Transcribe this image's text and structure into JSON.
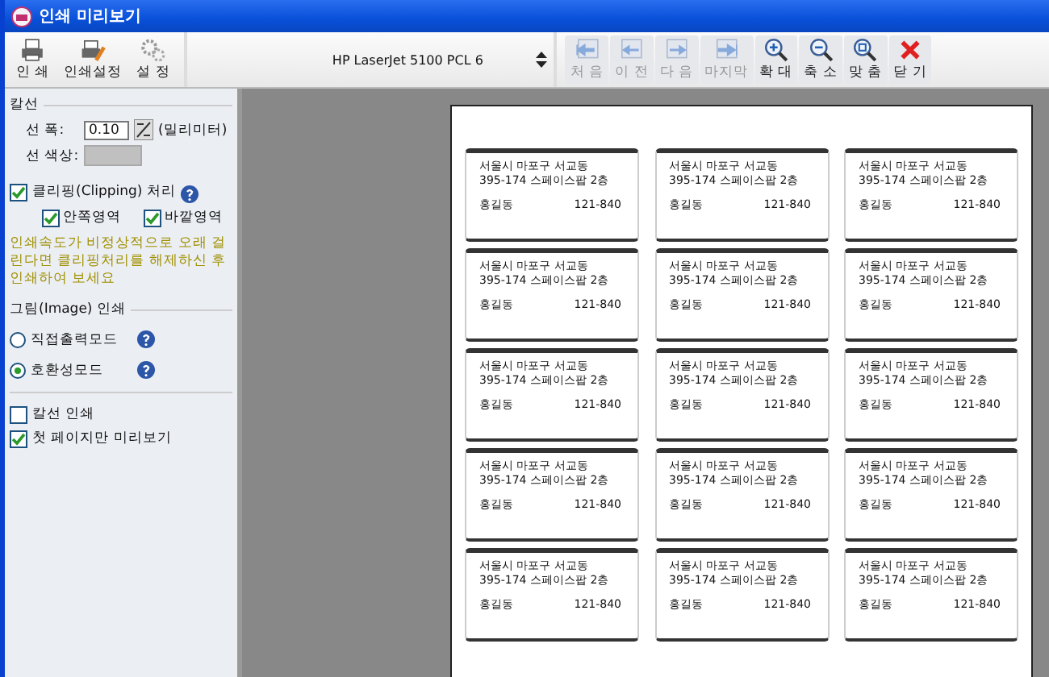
{
  "window": {
    "title": "인쇄 미리보기"
  },
  "toolbar": {
    "left_buttons": [
      {
        "kind": "print",
        "label": "인 쇄",
        "disabled": false
      },
      {
        "kind": "setup",
        "label": "인쇄설정",
        "disabled": false
      },
      {
        "kind": "settings",
        "label": "설 정",
        "disabled": false
      }
    ],
    "printer": "HP LaserJet 5100 PCL 6",
    "right_buttons": [
      {
        "kind": "first",
        "label": "처 음",
        "disabled": true
      },
      {
        "kind": "prev",
        "label": "이 전",
        "disabled": true
      },
      {
        "kind": "next",
        "label": "다 음",
        "disabled": true
      },
      {
        "kind": "last",
        "label": "마지막",
        "disabled": true
      },
      {
        "kind": "zoomin",
        "label": "확 대",
        "disabled": false
      },
      {
        "kind": "zoomout",
        "label": "축 소",
        "disabled": false
      },
      {
        "kind": "fit",
        "label": "맞 춤",
        "disabled": false
      },
      {
        "kind": "close",
        "label": "닫 기",
        "disabled": false
      }
    ]
  },
  "panel": {
    "cut_line": {
      "title": "칼선",
      "width_label": "선 폭:",
      "width_value": "0.10",
      "unit": "(밀리미터)",
      "color_label": "선 색상:"
    },
    "clipping": {
      "label": "클리핑(Clipping) 처리",
      "checked": true,
      "options": [
        {
          "label": "안쪽영역",
          "checked": true
        },
        {
          "label": "바깥영역",
          "checked": true
        }
      ],
      "note": "인쇄속도가 비정상적으로 오래 걸린다면 클리핑처리를 해제하신 후 인쇄하여 보세요"
    },
    "image": {
      "title": "그림(Image) 인쇄",
      "modes": [
        {
          "label": "직접출력모드",
          "selected": false
        },
        {
          "label": "호환성모드",
          "selected": true
        }
      ]
    },
    "options": [
      {
        "label": "칼선 인쇄",
        "checked": false
      },
      {
        "label": "첫 페이지만 미리보기",
        "checked": true
      }
    ]
  },
  "labels": [
    {
      "address_1": "서울시 마포구 서교동",
      "address_2": "395-174 스페이스팝 2층",
      "name": "홍길동",
      "zip": "121-840"
    },
    {
      "address_1": "서울시 마포구 서교동",
      "address_2": "395-174 스페이스팝 2층",
      "name": "홍길동",
      "zip": "121-840"
    },
    {
      "address_1": "서울시 마포구 서교동",
      "address_2": "395-174 스페이스팝 2층",
      "name": "홍길동",
      "zip": "121-840"
    },
    {
      "address_1": "서울시 마포구 서교동",
      "address_2": "395-174 스페이스팝 2층",
      "name": "홍길동",
      "zip": "121-840"
    },
    {
      "address_1": "서울시 마포구 서교동",
      "address_2": "395-174 스페이스팝 2층",
      "name": "홍길동",
      "zip": "121-840"
    },
    {
      "address_1": "서울시 마포구 서교동",
      "address_2": "395-174 스페이스팝 2층",
      "name": "홍길동",
      "zip": "121-840"
    },
    {
      "address_1": "서울시 마포구 서교동",
      "address_2": "395-174 스페이스팝 2층",
      "name": "홍길동",
      "zip": "121-840"
    },
    {
      "address_1": "서울시 마포구 서교동",
      "address_2": "395-174 스페이스팝 2층",
      "name": "홍길동",
      "zip": "121-840"
    },
    {
      "address_1": "서울시 마포구 서교동",
      "address_2": "395-174 스페이스팝 2층",
      "name": "홍길동",
      "zip": "121-840"
    },
    {
      "address_1": "서울시 마포구 서교동",
      "address_2": "395-174 스페이스팝 2층",
      "name": "홍길동",
      "zip": "121-840"
    },
    {
      "address_1": "서울시 마포구 서교동",
      "address_2": "395-174 스페이스팝 2층",
      "name": "홍길동",
      "zip": "121-840"
    },
    {
      "address_1": "서울시 마포구 서교동",
      "address_2": "395-174 스페이스팝 2층",
      "name": "홍길동",
      "zip": "121-840"
    },
    {
      "address_1": "서울시 마포구 서교동",
      "address_2": "395-174 스페이스팝 2층",
      "name": "홍길동",
      "zip": "121-840"
    },
    {
      "address_1": "서울시 마포구 서교동",
      "address_2": "395-174 스페이스팝 2층",
      "name": "홍길동",
      "zip": "121-840"
    },
    {
      "address_1": "서울시 마포구 서교동",
      "address_2": "395-174 스페이스팝 2층",
      "name": "홍길동",
      "zip": "121-840"
    }
  ]
}
